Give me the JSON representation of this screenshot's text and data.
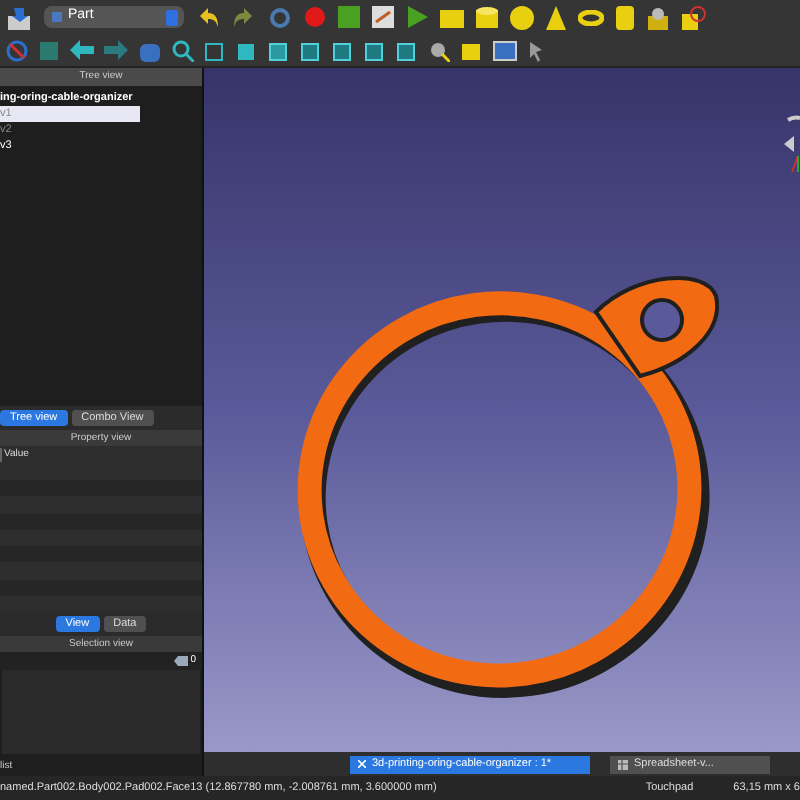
{
  "toolbar": {
    "workbench": "Part"
  },
  "tree_view": {
    "title": "Tree view",
    "items": [
      {
        "label": "ing-oring-cable-organizer",
        "selected": false,
        "disabled": false
      },
      {
        "label": "v1",
        "selected": true,
        "disabled": true
      },
      {
        "label": "v2",
        "selected": false,
        "disabled": true
      },
      {
        "label": "v3",
        "selected": false,
        "disabled": false
      }
    ]
  },
  "panel_tabs": [
    {
      "label": "Tree view",
      "selected": true
    },
    {
      "label": "Combo View",
      "selected": false
    }
  ],
  "property_view": {
    "title": "Property view",
    "columns": [
      "Value"
    ]
  },
  "property_tabs": [
    {
      "label": "View",
      "selected": true
    },
    {
      "label": "Data",
      "selected": false
    }
  ],
  "selection_view": {
    "title": "Selection view",
    "count": "0",
    "footer": "list"
  },
  "document_tabs": [
    {
      "label": "3d-printing-oring-cable-organizer : 1*",
      "selected": true,
      "kind": "document"
    },
    {
      "label": "Spreadsheet-v...",
      "selected": false,
      "kind": "spreadsheet"
    }
  ],
  "status_bar": {
    "message": "named.Part002.Body002.Pad002.Face13 (12.867780 mm, -2.008761 mm, 3.600000 mm)",
    "navigation": "Touchpad",
    "dimensions": "63,15 mm x 6"
  }
}
